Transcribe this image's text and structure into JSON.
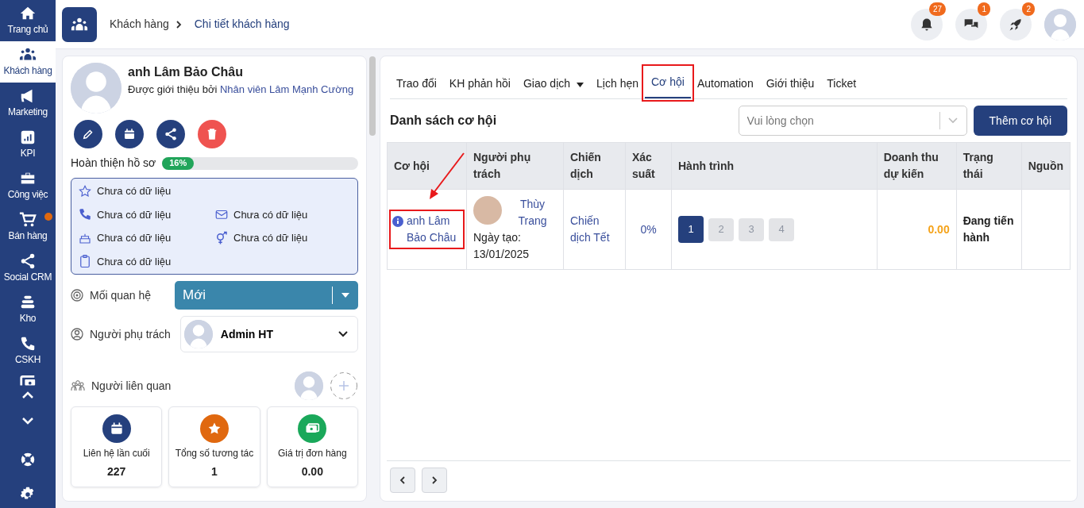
{
  "sidebar": {
    "items": [
      {
        "label": "Trang chủ",
        "selected": false,
        "dot": false
      },
      {
        "label": "Khách hàng",
        "selected": true,
        "dot": false
      },
      {
        "label": "Marketing",
        "selected": false,
        "dot": false
      },
      {
        "label": "KPI",
        "selected": false,
        "dot": false
      },
      {
        "label": "Công việc",
        "selected": false,
        "dot": false
      },
      {
        "label": "Bán hàng",
        "selected": false,
        "dot": true
      },
      {
        "label": "Social CRM",
        "selected": false,
        "dot": false
      },
      {
        "label": "Kho",
        "selected": false,
        "dot": false
      },
      {
        "label": "CSKH",
        "selected": false,
        "dot": false
      }
    ]
  },
  "header": {
    "breadcrumb": [
      {
        "label": "Khách hàng",
        "current": false
      },
      {
        "label": "Chi tiết khách hàng",
        "current": true
      }
    ],
    "notifications": [
      {
        "count": "27"
      },
      {
        "count": "1"
      },
      {
        "count": "2"
      }
    ]
  },
  "customer": {
    "name": "anh Lâm Bảo Châu",
    "referral_prefix": "Được giới thiệu bởi",
    "referrer": "Nhân viên Lâm Mạnh Cường",
    "actions": [
      {
        "kind": "normal"
      },
      {
        "kind": "normal"
      },
      {
        "kind": "normal"
      },
      {
        "kind": "danger"
      }
    ],
    "completion_label": "Hoàn thiện hồ sơ",
    "completion": {
      "level": 0.16,
      "reading": "16%"
    },
    "info": [
      "Chưa có dữ liệu",
      "Chưa có dữ liệu",
      "Chưa có dữ liệu",
      "Chưa có dữ liệu",
      "Chưa có dữ liệu",
      "Chưa có dữ liệu"
    ],
    "relationship_label": "Mối quan hệ",
    "relationship": "Mới",
    "owner_label": "Người phụ trách",
    "owner": "Admin HT",
    "related_label": "Người liên quan",
    "stats": [
      {
        "color": "#25407d",
        "label": "Liên hệ lần cuối",
        "value": "227"
      },
      {
        "color": "#e0680f",
        "label": "Tổng số tương tác",
        "value": "1"
      },
      {
        "color": "#1aa85a",
        "label": "Giá trị đơn hàng",
        "value": "0.00"
      }
    ]
  },
  "tabs": [
    {
      "label": "Trao đổi",
      "selected": false,
      "dropdown": false,
      "highlighted": false
    },
    {
      "label": "KH phản hồi",
      "selected": false,
      "dropdown": false,
      "highlighted": false
    },
    {
      "label": "Giao dịch",
      "selected": false,
      "dropdown": true,
      "highlighted": false
    },
    {
      "label": "Lịch hẹn",
      "selected": false,
      "dropdown": false,
      "highlighted": false
    },
    {
      "label": "Cơ hội",
      "selected": true,
      "dropdown": false,
      "highlighted": true
    },
    {
      "label": "Automation",
      "selected": false,
      "dropdown": false,
      "highlighted": false
    },
    {
      "label": "Giới thiệu",
      "selected": false,
      "dropdown": false,
      "highlighted": false
    },
    {
      "label": "Ticket",
      "selected": false,
      "dropdown": false,
      "highlighted": false
    }
  ],
  "list": {
    "title": "Danh sách cơ hội",
    "filter": {
      "placeholder": "Vui lòng chọn"
    },
    "add_button": "Thêm cơ hội",
    "table": {
      "columns": [
        "Cơ hội",
        "Người phụ trách",
        "Chiến dịch",
        "Xác suất",
        "Hành trình",
        "Doanh thu dự kiến",
        "Trạng thái",
        "Nguồn"
      ],
      "rows": [
        {
          "opportunity": "anh Lâm Bảo Châu",
          "highlighted": true,
          "pointer_arrow": true,
          "owner": "Thùy Trang",
          "created": "Ngày tạo: 13/01/2025",
          "campaign": "Chiến dịch Tết",
          "probability": "0%",
          "steps": [
            {
              "label": "1",
              "selected": true
            },
            {
              "label": "2",
              "selected": false
            },
            {
              "label": "3",
              "selected": false
            },
            {
              "label": "4",
              "selected": false
            }
          ],
          "revenue": "0.00",
          "status": "Đang tiến hành"
        }
      ]
    }
  }
}
